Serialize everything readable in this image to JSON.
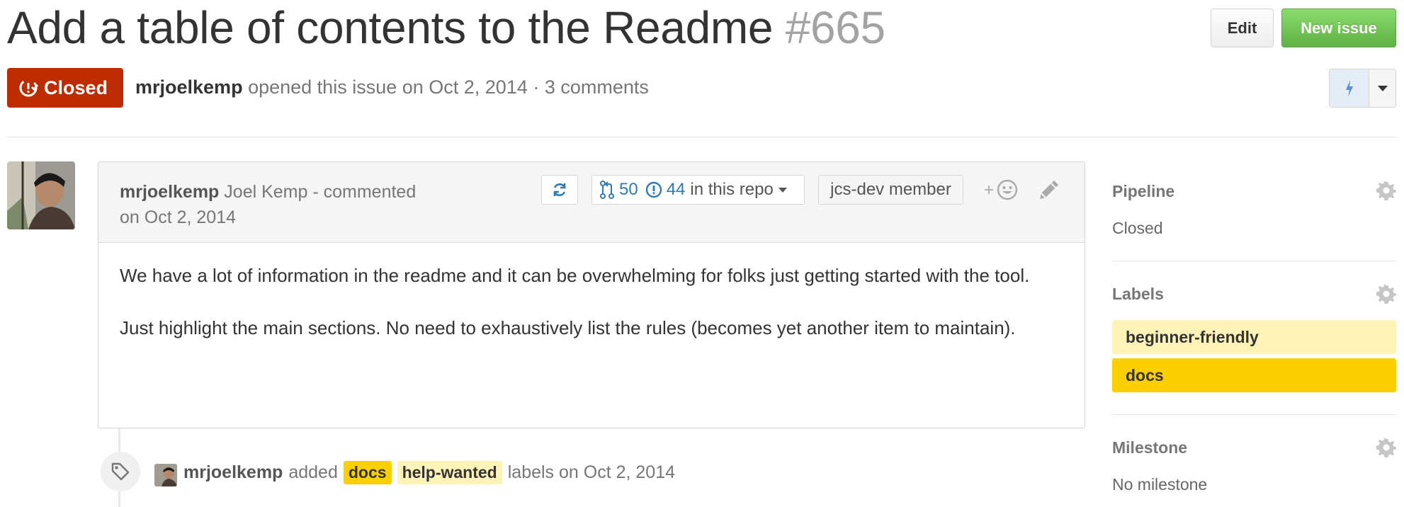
{
  "issue": {
    "title": "Add a table of contents to the Readme",
    "number": "#665",
    "state": "Closed",
    "author": "mrjoelkemp",
    "opened_text": "opened this issue on Oct 2, 2014 · 3 comments"
  },
  "header": {
    "edit_label": "Edit",
    "new_issue_label": "New issue"
  },
  "comment": {
    "author": "mrjoelkemp",
    "author_meta": "Joel Kemp - commented",
    "date": "on Oct 2, 2014",
    "pr_count": "50",
    "issue_count": "44",
    "repo_text": "in this repo",
    "member_badge": "jcs-dev member",
    "body": [
      "We have a lot of information in the readme and it can be overwhelming for folks just getting started with the tool.",
      "Just highlight the main sections. No need to exhaustively list the rules (becomes yet another item to maintain)."
    ]
  },
  "event": {
    "author": "mrjoelkemp",
    "action": "added",
    "labels": [
      {
        "name": "docs",
        "color": "#fcd000"
      },
      {
        "name": "help-wanted",
        "color": "#fff3b8"
      }
    ],
    "suffix": "labels on Oct 2, 2014"
  },
  "sidebar": {
    "pipeline": {
      "heading": "Pipeline",
      "value": "Closed"
    },
    "labels": {
      "heading": "Labels",
      "items": [
        {
          "name": "beginner-friendly",
          "color": "#fff3b8"
        },
        {
          "name": "docs",
          "color": "#fcd000"
        }
      ]
    },
    "milestone": {
      "heading": "Milestone",
      "value": "No milestone"
    }
  },
  "colors": {
    "closed": "#bd2c00",
    "new_issue": "#6cc644",
    "link_blue": "#2b7bb9"
  }
}
